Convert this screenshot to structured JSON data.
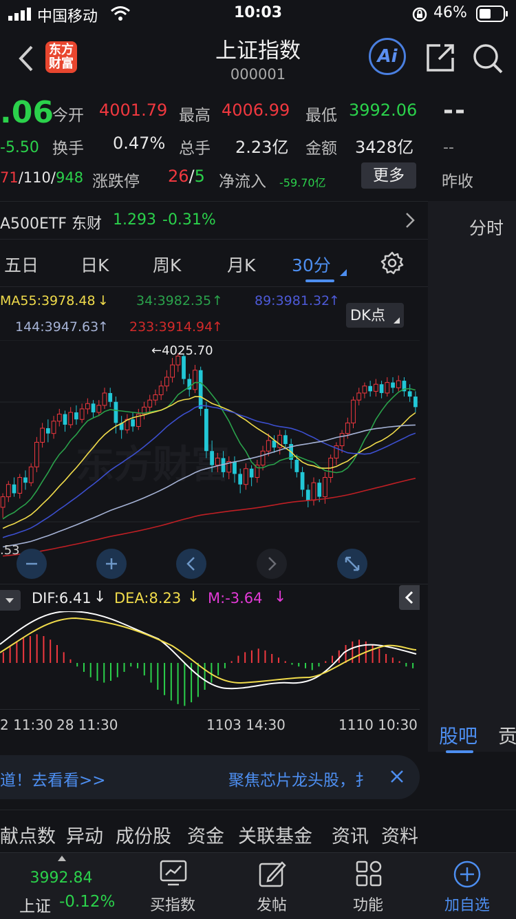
{
  "status_bar": {
    "carrier": "中国移动",
    "time": "10:03",
    "battery": "46%"
  },
  "nav": {
    "title": "上证指数",
    "code": "000001",
    "logo_line1": "东方",
    "logo_line2": "财富",
    "ai_label": "Ai"
  },
  "quote": {
    "price_partial": ".06",
    "change_partial": "-5.50",
    "open_label": "今开",
    "open_value": "4001.79",
    "high_label": "最高",
    "high_value": "4006.99",
    "low_label": "最低",
    "low_value": "3992.06",
    "turnover_label": "换手",
    "turnover_value": "0.47%",
    "volume_label": "总手",
    "volume_value": "2.23亿",
    "amount_label": "金额",
    "amount_value": "3428亿",
    "adv_up": "71",
    "adv_flat": "/110/",
    "adv_down": "948",
    "limit_label": "涨跌停",
    "limit_up": "26",
    "limit_sep": "/",
    "limit_down": "5",
    "netflow_label": "净流入",
    "netflow_value": "-59.70亿",
    "more_button": "更多",
    "prev_close_dash": "--",
    "prev_close_dash2": "--",
    "prev_close_label": "昨收"
  },
  "etf": {
    "name": "A500ETF 东财",
    "price": "1.293",
    "change": "-0.31%"
  },
  "right_panel": {
    "fenshi_tab": "分时",
    "guba_tab": "股吧",
    "gong_tab": "贡"
  },
  "period_tabs": [
    {
      "label": "五日"
    },
    {
      "label": "日K"
    },
    {
      "label": "周K"
    },
    {
      "label": "月K"
    },
    {
      "label": "30分"
    }
  ],
  "ma": {
    "ma55": "MA55:3978.48",
    "ma34": "34:3982.35",
    "ma89": "89:3981.32",
    "ma144": "144:3947.63",
    "ma233": "233:3914.94",
    "dk_button": "DK点"
  },
  "chart_annotation": {
    "high_label": "←4025.70",
    "left_label": ".53",
    "watermark": "东方财富"
  },
  "macd": {
    "dif": "DIF:6.41",
    "dea": "DEA:8.23",
    "m": "M:-3.64"
  },
  "time_axis": [
    "2 11:30",
    "28 11:30",
    "1103 14:30",
    "1110 10:30"
  ],
  "banner": {
    "left_text": "道！去看看>>",
    "right_text": "聚焦芯片龙头股，扌"
  },
  "feature_tabs": [
    "献点数",
    "异动",
    "成份股",
    "资金",
    "关联基金",
    "资讯",
    "资料"
  ],
  "bottom_nav": {
    "index_value": "3992.84",
    "index_name": "上证",
    "index_change": "-0.12%",
    "buy_label": "买指数",
    "post_label": "发帖",
    "func_label": "功能",
    "fav_label": "加自选"
  },
  "chart_data": {
    "type": "candlestick",
    "period": "30分",
    "annotated_high": 4025.7,
    "candles": [
      [
        3938,
        3944,
        3932,
        3946
      ],
      [
        3944,
        3951,
        3941,
        3953
      ],
      [
        3951,
        3946,
        3944,
        3955
      ],
      [
        3946,
        3955,
        3943,
        3957
      ],
      [
        3955,
        3952,
        3948,
        3959
      ],
      [
        3952,
        3961,
        3950,
        3963
      ],
      [
        3961,
        3975,
        3958,
        3978
      ],
      [
        3975,
        3983,
        3972,
        3986
      ],
      [
        3983,
        3980,
        3975,
        3988
      ],
      [
        3980,
        3987,
        3977,
        3990
      ],
      [
        3987,
        3991,
        3984,
        3994
      ],
      [
        3991,
        3985,
        3981,
        3993
      ],
      [
        3985,
        3992,
        3983,
        3995
      ],
      [
        3992,
        3988,
        3985,
        3996
      ],
      [
        3988,
        3994,
        3986,
        3997
      ],
      [
        3994,
        3997,
        3991,
        4000
      ],
      [
        3997,
        3992,
        3989,
        3999
      ],
      [
        3992,
        3996,
        3990,
        3999
      ],
      [
        3996,
        4003,
        3994,
        4006
      ],
      [
        4003,
        3998,
        3995,
        4006
      ],
      [
        3998,
        3986,
        3980,
        4001
      ],
      [
        3986,
        3982,
        3977,
        3990
      ],
      [
        3982,
        3988,
        3980,
        3991
      ],
      [
        3988,
        3984,
        3981,
        3992
      ],
      [
        3984,
        3991,
        3982,
        3994
      ],
      [
        3991,
        3995,
        3988,
        3998
      ],
      [
        3995,
        3999,
        3992,
        4002
      ],
      [
        3999,
        4002,
        3996,
        4005
      ],
      [
        4002,
        4007,
        3999,
        4010
      ],
      [
        4007,
        4012,
        4004,
        4016
      ],
      [
        4012,
        4019,
        4009,
        4023
      ],
      [
        4019,
        4024,
        4015,
        4025.7
      ],
      [
        4024,
        4011,
        4008,
        4025
      ],
      [
        4011,
        4005,
        4001,
        4014
      ],
      [
        4005,
        4016,
        4003,
        4019
      ],
      [
        4016,
        3994,
        3990,
        4018
      ],
      [
        3994,
        3970,
        3966,
        3998
      ],
      [
        3970,
        3962,
        3958,
        3976
      ],
      [
        3962,
        3966,
        3958,
        3969
      ],
      [
        3966,
        3958,
        3955,
        3970
      ],
      [
        3958,
        3964,
        3954,
        3967
      ],
      [
        3964,
        3957,
        3952,
        3967
      ],
      [
        3957,
        3951,
        3946,
        3960
      ],
      [
        3951,
        3960,
        3948,
        3963
      ],
      [
        3960,
        3955,
        3950,
        3962
      ],
      [
        3955,
        3962,
        3952,
        3965
      ],
      [
        3962,
        3970,
        3959,
        3973
      ],
      [
        3970,
        3976,
        3967,
        3980
      ],
      [
        3976,
        3972,
        3969,
        3979
      ],
      [
        3972,
        3979,
        3968,
        3982
      ],
      [
        3979,
        3974,
        3971,
        3982
      ],
      [
        3974,
        3965,
        3960,
        3977
      ],
      [
        3965,
        3958,
        3955,
        3968
      ],
      [
        3958,
        3948,
        3944,
        3961
      ],
      [
        3948,
        3942,
        3938,
        3951
      ],
      [
        3942,
        3952,
        3939,
        3955
      ],
      [
        3952,
        3944,
        3941,
        3954
      ],
      [
        3944,
        3955,
        3940,
        3958
      ],
      [
        3955,
        3966,
        3952,
        3968
      ],
      [
        3966,
        3973,
        3962,
        3975
      ],
      [
        3973,
        3980,
        3969,
        3982
      ],
      [
        3980,
        3986,
        3977,
        3989
      ],
      [
        3986,
        3999,
        3983,
        4001
      ],
      [
        3999,
        4003,
        3996,
        4006
      ],
      [
        4003,
        4007,
        4000,
        4009
      ],
      [
        4007,
        4004,
        4001,
        4010
      ],
      [
        4004,
        4008,
        4001,
        4011
      ],
      [
        4008,
        4003,
        4000,
        4010
      ],
      [
        4003,
        4009,
        4001,
        4012
      ],
      [
        4009,
        4006,
        4003,
        4012
      ],
      [
        4006,
        4010,
        4004,
        4013
      ],
      [
        4010,
        4004,
        4001,
        4012
      ],
      [
        4004,
        4001,
        3998,
        4008
      ],
      [
        4001,
        3995,
        3992,
        4004
      ]
    ],
    "macd_hist": [
      6,
      9,
      12,
      14,
      15,
      16,
      15,
      13,
      10,
      6,
      2,
      -2,
      -5,
      -8,
      -10,
      -11,
      -10,
      -8,
      -5,
      -2,
      -3,
      -7,
      -11,
      -15,
      -18,
      -21,
      -23,
      -24,
      -22,
      -19,
      -15,
      -11,
      -7,
      -3,
      1,
      4,
      6,
      7,
      8,
      7,
      5,
      3,
      1,
      -1,
      -2,
      -3,
      -4,
      -2,
      1,
      4,
      7,
      10,
      12,
      13,
      12,
      10,
      8,
      5,
      3,
      1,
      -2,
      -3
    ]
  }
}
